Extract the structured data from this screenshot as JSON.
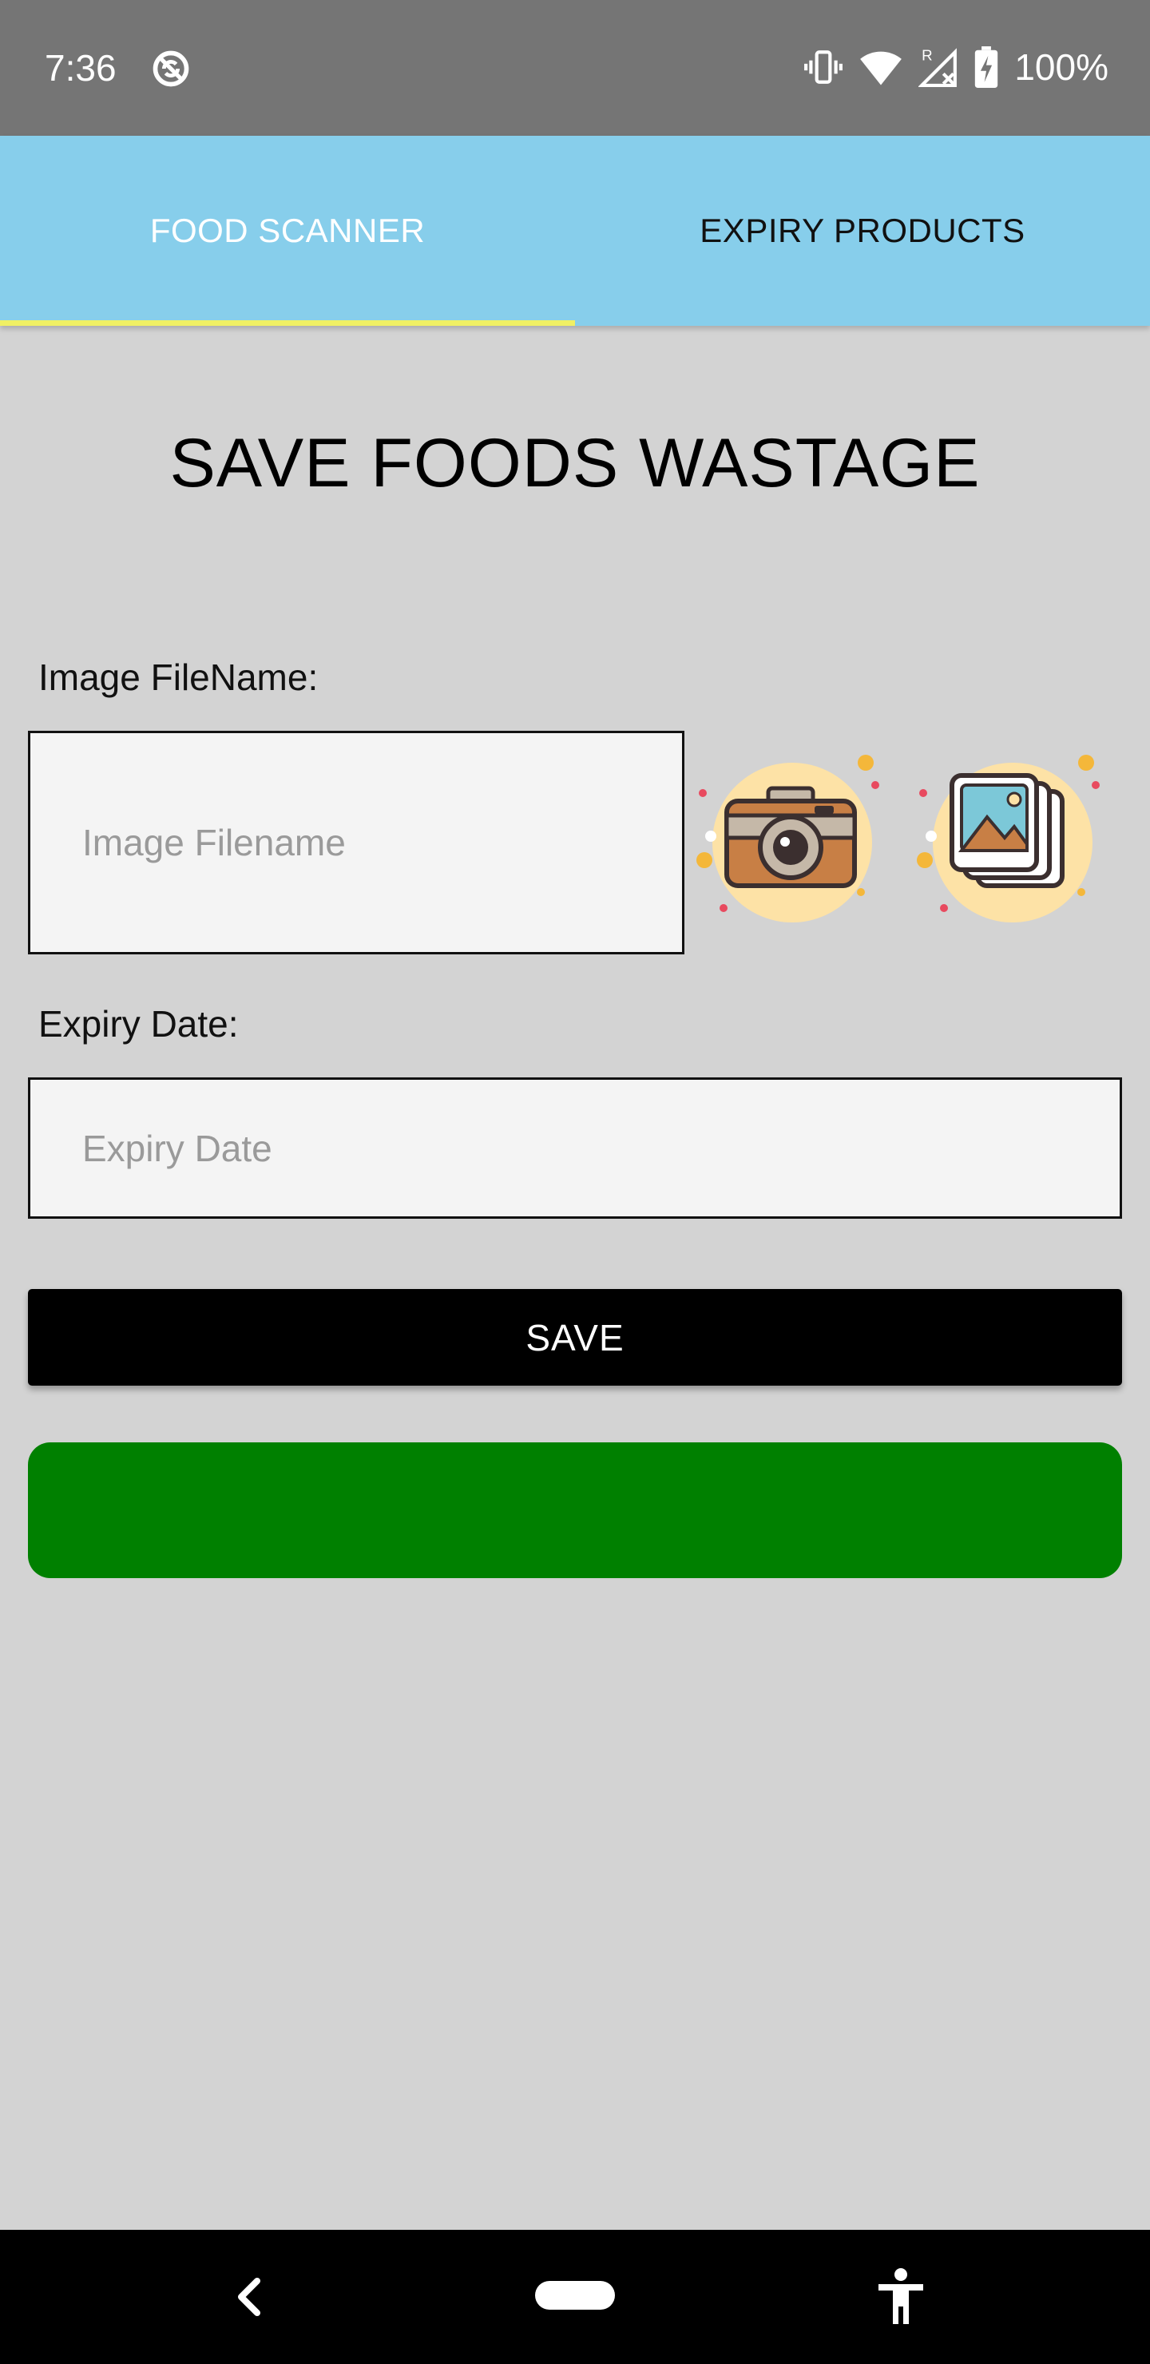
{
  "status_bar": {
    "time": "7:36",
    "battery_percent": "100%",
    "icons": [
      "sync-disabled-icon",
      "vibrate-icon",
      "wifi-icon",
      "signal-roaming-icon",
      "battery-charging-icon"
    ]
  },
  "tabs": [
    {
      "label": "FOOD SCANNER",
      "selected": true
    },
    {
      "label": "EXPIRY PRODUCTS",
      "selected": false
    }
  ],
  "page": {
    "title": "SAVE FOODS WASTAGE"
  },
  "form": {
    "image_label": "Image FileName:",
    "image_placeholder": "Image Filename",
    "image_value": "",
    "expiry_label": "Expiry Date:",
    "expiry_placeholder": "Expiry Date",
    "expiry_value": "",
    "save_label": "SAVE"
  },
  "icons": {
    "camera": "camera-icon",
    "gallery": "gallery-icon"
  },
  "colors": {
    "status_bar": "#757575",
    "tab_bar": "#87ceeb",
    "tab_indicator": "#f0f064",
    "background": "#d3d3d3",
    "save_button": "#000000",
    "green_bar": "#008000"
  },
  "nav_bar": {
    "icons": [
      "back-icon",
      "home-pill-icon",
      "accessibility-icon"
    ]
  }
}
